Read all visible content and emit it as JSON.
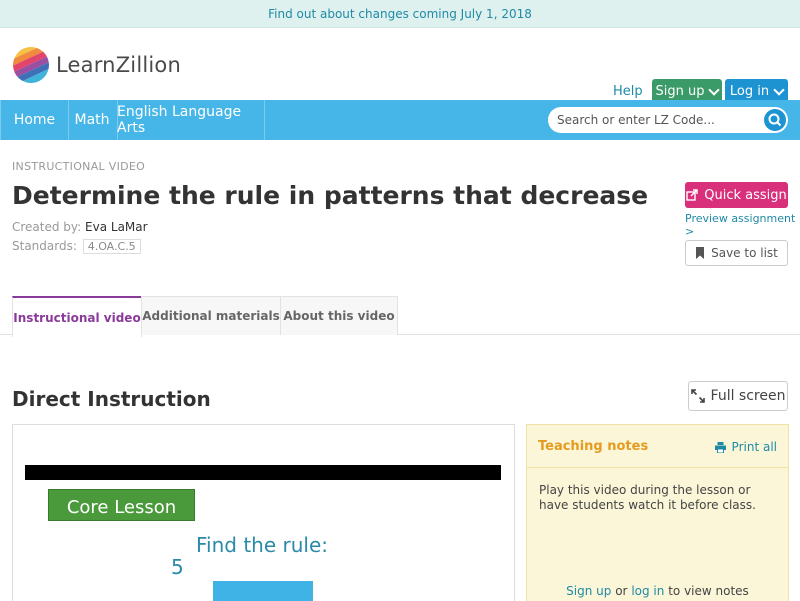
{
  "banner": {
    "text": "Find out about changes coming July 1, 2018"
  },
  "header": {
    "logo_text": "LearnZillion",
    "help": "Help",
    "signup": "Sign up",
    "login": "Log in"
  },
  "nav": {
    "items": [
      "Home",
      "Math",
      "English Language Arts"
    ],
    "search_placeholder": "Search or enter LZ Code..."
  },
  "lesson": {
    "eyebrow": "INSTRUCTIONAL VIDEO",
    "title": "Determine the rule in patterns that decrease",
    "created_label": "Created by:",
    "author": "Eva LaMar",
    "standards_label": "Standards:",
    "standard": "4.OA.C.5"
  },
  "actions": {
    "quick_assign": "Quick assign",
    "preview": "Preview assignment >",
    "save": "Save to list"
  },
  "tabs": [
    "Instructional video",
    "Additional materials",
    "About this video"
  ],
  "section": {
    "title": "Direct Instruction",
    "fullscreen": "Full screen"
  },
  "video": {
    "badge": "Core Lesson",
    "prompt": "Find the rule:",
    "number": "5"
  },
  "notes": {
    "title": "Teaching notes",
    "print": "Print all",
    "body": "Play this video during the lesson or have students watch it before class.",
    "signup": "Sign up",
    "or": "or",
    "login": "log in",
    "suffix": "to view notes"
  },
  "colors": {
    "accent": "#45b6e7",
    "signup": "#3a9b68",
    "login": "#1d93d2",
    "quick_assign": "#d8307b",
    "tab_active": "#8a3a9a"
  }
}
